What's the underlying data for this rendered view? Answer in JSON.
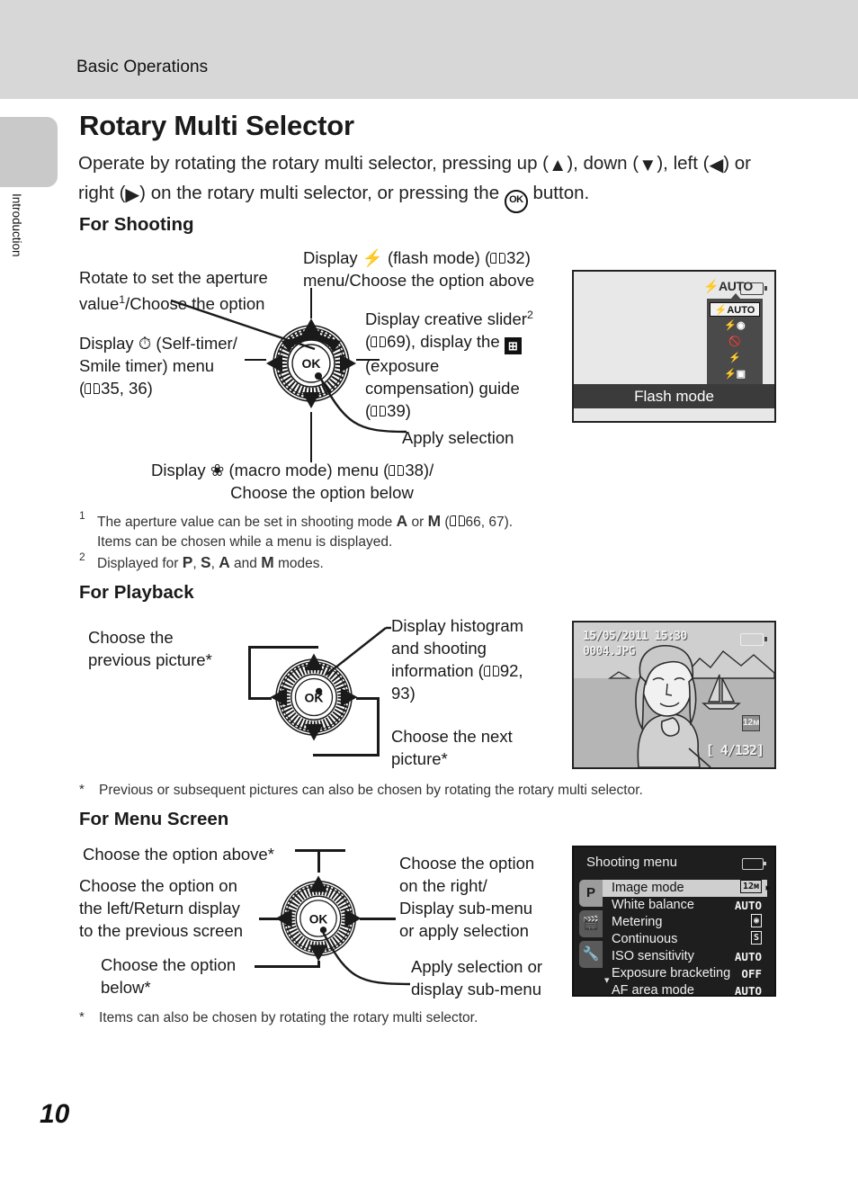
{
  "header": {
    "running_head": "Basic Operations"
  },
  "side_tab": {
    "label": "Introduction"
  },
  "page": {
    "number": "10"
  },
  "title": "Rotary Multi Selector",
  "intro": {
    "line1_a": "Operate by rotating the rotary multi selector, pressing up (",
    "up": "▲",
    "line1_b": "), down (",
    "down": "▼",
    "line1_c": "), left (",
    "left": "◀",
    "line1_d": ")",
    "line2_a": "or right (",
    "right": "▶",
    "line2_b": ") on the rotary multi selector, or pressing the ",
    "ok": "OK",
    "line2_c": " button."
  },
  "sections": {
    "shooting": "For Shooting",
    "playback": "For Playback",
    "menu": "For Menu Screen"
  },
  "shooting_labels": {
    "rotate_aperture_l1": "Rotate to set the aperture",
    "rotate_aperture_l2_a": "value",
    "rotate_aperture_sup": "1",
    "rotate_aperture_l2_b": "/Choose the option",
    "flash_l1_a": "Display ",
    "flash_icon": "flash-bolt-icon",
    "flash_l1_b": " (flash mode) (",
    "flash_ref": "32",
    "flash_l1_c": ")",
    "flash_l2": "menu/Choose the option above",
    "selftimer_l1_a": "Display ",
    "selftimer_icon": "self-timer-icon",
    "selftimer_l1_b": " (Self-timer/",
    "selftimer_l2": "Smile timer) menu",
    "selftimer_l3_a": "(",
    "selftimer_ref": "35, 36",
    "selftimer_l3_b": ")",
    "creative_l1": "Display creative slider",
    "creative_sup": "2",
    "creative_l2_a": "(",
    "creative_ref1": "69",
    "creative_l2_b": "), display the ",
    "creative_ev_icon": "exposure-compensation-icon",
    "creative_l3": "(exposure",
    "creative_l4": "compensation) guide",
    "creative_l5_a": "(",
    "creative_ref2": "39",
    "creative_l5_b": ")",
    "apply_selection": "Apply selection",
    "macro_l1_a": "Display ",
    "macro_icon": "macro-flower-icon",
    "macro_l1_b": " (macro mode) menu (",
    "macro_ref": "38",
    "macro_l1_c": ")/",
    "macro_l2": "Choose the option below"
  },
  "footnotes_shooting": [
    {
      "mark": "1",
      "line1_a": "The aperture value can be set in shooting mode ",
      "mode_a": "A",
      "line1_b": " or ",
      "mode_m": "M",
      "line1_c": " (",
      "ref": "66, 67",
      "line1_d": ").",
      "line2": "Items can be chosen while a menu is displayed."
    },
    {
      "mark": "2",
      "line1_a": "Displayed for ",
      "mode_p": "P",
      "sep1": ", ",
      "mode_s": "S",
      "sep2": ", ",
      "mode_a": "A",
      "sep3": " and ",
      "mode_m": "M",
      "line1_b": " modes."
    }
  ],
  "playback_labels": {
    "prev_l1": "Choose the",
    "prev_l2": "previous picture*",
    "hist_l1": "Display histogram",
    "hist_l2": "and shooting",
    "hist_l3_a": "information (",
    "hist_ref": "92,",
    "hist_l4": "93)",
    "next_l1": "Choose the next",
    "next_l2": "picture*"
  },
  "footnote_playback": {
    "mark": "*",
    "text": "Previous or subsequent pictures can also be chosen by rotating the rotary multi selector."
  },
  "menu_labels": {
    "above": "Choose the option above*",
    "left_l1": "Choose the option on",
    "left_l2": "the left/Return display",
    "left_l3": "to the previous screen",
    "below_l1": "Choose the option",
    "below_l2": "below*",
    "right_l1": "Choose the option",
    "right_l2": "on the right/",
    "right_l3": "Display sub-menu",
    "right_l4": "or apply selection",
    "apply_l1": "Apply selection or",
    "apply_l2": "display sub-menu"
  },
  "footnote_menu": {
    "mark": "*",
    "text": "Items can also be chosen by rotating the rotary multi selector."
  },
  "lcd_flash": {
    "status_icon_label": "AUTO",
    "caption": "Flash mode",
    "items": [
      {
        "label": "AUTO",
        "name": "flash-auto",
        "selected": true
      },
      {
        "label": "red-eye",
        "name": "flash-red-eye",
        "selected": false
      },
      {
        "label": "off",
        "name": "flash-off",
        "selected": false
      },
      {
        "label": "fill",
        "name": "flash-fill",
        "selected": false
      },
      {
        "label": "slow-sync",
        "name": "flash-slow-sync",
        "selected": false
      }
    ]
  },
  "lcd_playback": {
    "datetime": "15/05/2011  15:30",
    "filename": "0004.JPG",
    "image_mode": "12м",
    "frame_counter": "[  4/132]"
  },
  "lcd_menu": {
    "title": "Shooting menu",
    "tabs": [
      {
        "label": "P",
        "name": "menu-tab-shooting",
        "active": true
      },
      {
        "label": "movie",
        "name": "menu-tab-movie",
        "active": false
      },
      {
        "label": "wrench",
        "name": "menu-tab-setup",
        "active": false
      }
    ],
    "rows": [
      {
        "label": "Image mode",
        "value": "12м",
        "selected": true
      },
      {
        "label": "White balance",
        "value": "AUTO",
        "selected": false
      },
      {
        "label": "Metering",
        "value": "",
        "selected": false
      },
      {
        "label": "Continuous",
        "value": "",
        "selected": false
      },
      {
        "label": "ISO sensitivity",
        "value": "AUTO",
        "selected": false
      },
      {
        "label": "Exposure bracketing",
        "value": "OFF",
        "selected": false
      },
      {
        "label": "AF area mode",
        "value": "AUTO",
        "selected": false
      }
    ]
  },
  "colors": {
    "header_band": "#d7d7d7",
    "side_tab": "#c9c9c9",
    "lcd_screen_bg": "#e8e8e8",
    "lcd_menu_bg": "#1e1e1e",
    "text": "#1a1a1a"
  }
}
